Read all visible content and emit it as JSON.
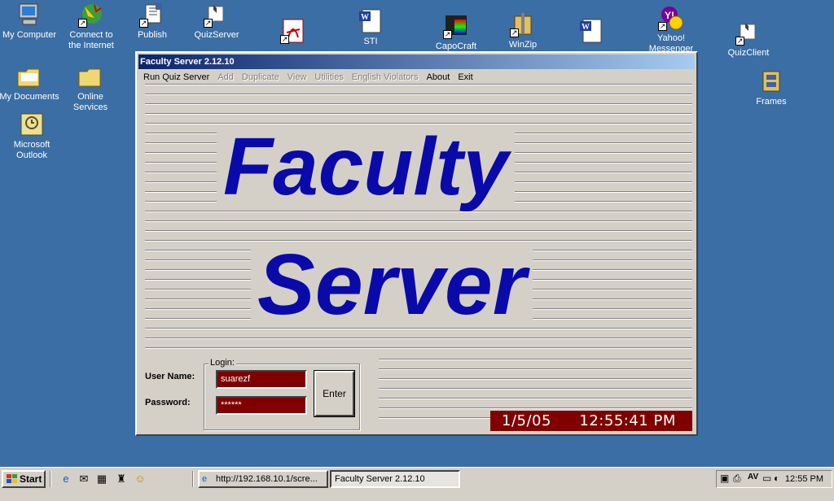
{
  "desktop": {
    "icons": [
      {
        "label": "My Computer"
      },
      {
        "label": "Connect to the Internet"
      },
      {
        "label": "Publish"
      },
      {
        "label": "QuizServer"
      },
      {
        "label": "STI"
      },
      {
        "label": "CapoCraft"
      },
      {
        "label": "WinZip"
      },
      {
        "label": "Yahoo! Messenger"
      },
      {
        "label": "QuizClient"
      },
      {
        "label": "My Documents"
      },
      {
        "label": "Online Services"
      },
      {
        "label": "Frames"
      },
      {
        "label": "Microsoft Outlook"
      }
    ]
  },
  "window": {
    "title": "Faculty Server 2.12.10",
    "menu": [
      {
        "label": "Run Quiz Server",
        "enabled": true
      },
      {
        "label": "Add",
        "enabled": false
      },
      {
        "label": "Duplicate",
        "enabled": false
      },
      {
        "label": "View",
        "enabled": false
      },
      {
        "label": "Utilities",
        "enabled": false
      },
      {
        "label": "English Violators",
        "enabled": false
      },
      {
        "label": "About",
        "enabled": true
      },
      {
        "label": "Exit",
        "enabled": true
      }
    ],
    "banner_line1": "Faculty",
    "banner_line2": "Server",
    "login": {
      "group_label": "Login:",
      "username_label": "User Name:",
      "username_value": "suarezf",
      "password_label": "Password:",
      "password_value": "******",
      "enter_label": "Enter"
    },
    "date": "1/5/05",
    "time": "12:55:41 PM"
  },
  "taskbar": {
    "start_label": "Start",
    "tasks": [
      {
        "label": "http://192.168.10.1/scre..."
      },
      {
        "label": "Faculty Server 2.12.10"
      }
    ],
    "clock": "12:55 PM"
  },
  "colors": {
    "desktop": "#3a6ea5",
    "banner_text": "#0a0aaa",
    "field_bg": "#800000",
    "title_gradient_start": "#0a246a"
  }
}
